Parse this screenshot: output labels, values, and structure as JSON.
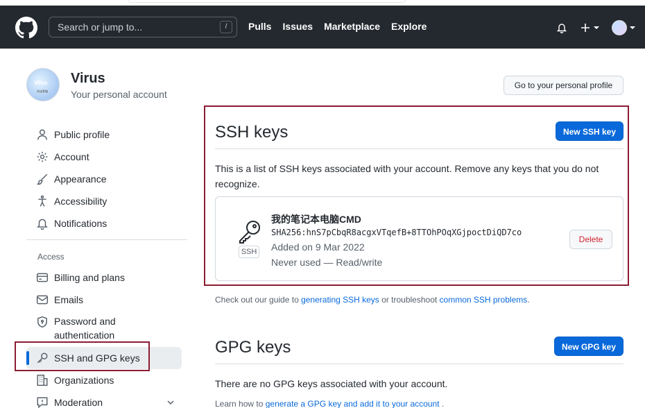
{
  "header": {
    "search_placeholder": "Search or jump to...",
    "search_shortcut": "/",
    "nav": [
      "Pulls",
      "Issues",
      "Marketplace",
      "Explore"
    ]
  },
  "profile": {
    "name": "Virus",
    "subtitle": "Your personal account",
    "avatar_text": "Virus",
    "avatar_subtext": "地迷素编",
    "go_profile_label": "Go to your personal profile"
  },
  "sidebar": {
    "items": [
      {
        "label": "Public profile",
        "icon": "person-icon"
      },
      {
        "label": "Account",
        "icon": "gear-icon"
      },
      {
        "label": "Appearance",
        "icon": "paintbrush-icon"
      },
      {
        "label": "Accessibility",
        "icon": "accessibility-icon"
      },
      {
        "label": "Notifications",
        "icon": "bell-icon"
      }
    ],
    "access_heading": "Access",
    "access_items": [
      {
        "label": "Billing and plans",
        "icon": "credit-card-icon"
      },
      {
        "label": "Emails",
        "icon": "mail-icon"
      },
      {
        "label": "Password and authentication",
        "label_line1": "Password and",
        "label_line2": "authentication",
        "icon": "shield-lock-icon"
      },
      {
        "label": "SSH and GPG keys",
        "icon": "key-icon"
      },
      {
        "label": "Organizations",
        "icon": "organization-icon"
      },
      {
        "label": "Moderation",
        "icon": "report-icon"
      }
    ]
  },
  "ssh": {
    "title": "SSH keys",
    "new_button": "New SSH key",
    "description": "This is a list of SSH keys associated with your account. Remove any keys that you do not recognize.",
    "key": {
      "title": "我的笔记本电脑CMD",
      "fingerprint": "SHA256:hnS7pCbqR8acgxVTqefB+8TTOhPOqXGjpoctDiQD7co",
      "added": "Added on 9 Mar 2022",
      "usage": "Never used — Read/write",
      "badge": "SSH",
      "delete_label": "Delete"
    },
    "guide_prefix": "Check out our guide to ",
    "guide_link1": "generating SSH keys",
    "guide_middle": " or troubleshoot ",
    "guide_link2": "common SSH problems",
    "guide_suffix": "."
  },
  "gpg": {
    "title": "GPG keys",
    "new_button": "New GPG key",
    "empty": "There are no GPG keys associated with your account.",
    "learn_prefix": "Learn how to ",
    "learn_link": "generate a GPG key and add it to your account",
    "learn_suffix": " ."
  },
  "colors": {
    "header_bg": "#24292f",
    "primary": "#0969da",
    "annotation_red": "#8b1c33",
    "danger": "#cf222e"
  }
}
